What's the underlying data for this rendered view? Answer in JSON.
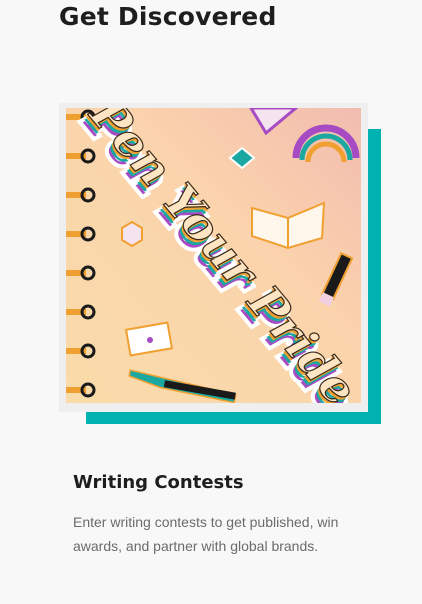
{
  "section": {
    "title": "Get Discovered"
  },
  "card": {
    "image_text": "Pen Your Pride",
    "title": "Writing Contests",
    "description": "Enter writing contests to get published, win awards, and partner with global brands."
  },
  "colors": {
    "accent": "#00b2b1",
    "text": "#1e1e1e",
    "muted": "#6b6b6b"
  }
}
